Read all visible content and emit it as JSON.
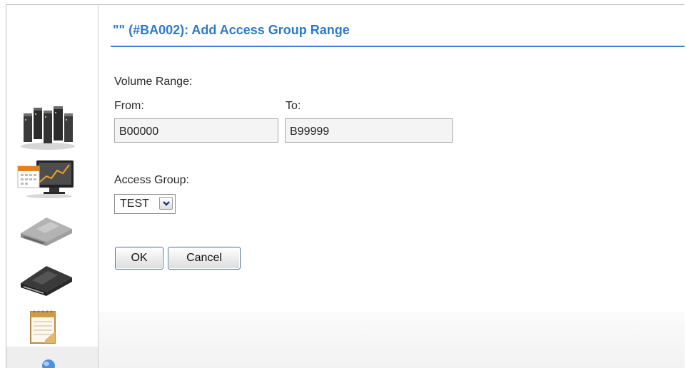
{
  "dialog": {
    "title": "\"\" (#BA002): Add Access Group Range"
  },
  "volume_range": {
    "section_label": "Volume Range:",
    "from_label": "From:",
    "from_value": "B00000",
    "to_label": "To:",
    "to_value": "B99999"
  },
  "access_group": {
    "label": "Access Group:",
    "selected": "TEST"
  },
  "buttons": {
    "ok": "OK",
    "cancel": "Cancel"
  },
  "sidebar": {
    "icons": [
      "server-cluster-icon",
      "monitor-chart-icon",
      "tape-drive-gray-icon",
      "tape-drive-black-icon",
      "calendar-notepad-icon",
      "globe-icon"
    ]
  },
  "colors": {
    "title": "#2f79c8",
    "rule": "#3a87d8"
  }
}
